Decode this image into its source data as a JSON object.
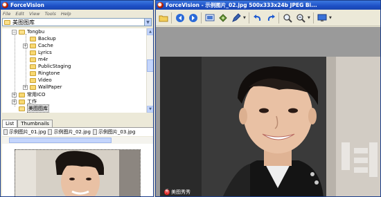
{
  "left_window": {
    "title": "ForceVision",
    "menu": [
      "File",
      "Edit",
      "View",
      "Tools",
      "Help"
    ],
    "path_combo": "美图图库",
    "tree": {
      "root": "Tongbu",
      "items": [
        "Backup",
        "Cache",
        "Lyrics",
        "m4r",
        "PublicStaging",
        "Ringtone",
        "Video",
        "WallPaper"
      ],
      "siblings": [
        "常用ICO",
        "工作"
      ],
      "selected": "美图图库"
    },
    "tabs": [
      "List",
      "Thumbnails"
    ],
    "thumb_files": [
      "示例图片_01.jpg",
      "示例图片_02.jpg",
      "示例图片_03.jpg"
    ]
  },
  "right_window": {
    "title": "ForceVision - 示例图片_02.jpg  500x333x24b  JPEG Bi..."
  },
  "watermark": {
    "text": "美图秀秀"
  },
  "icons": [
    "folder-icon",
    "back-icon",
    "forward-icon",
    "view-icon",
    "crop-icon",
    "pen-icon",
    "undo-icon",
    "redo-icon",
    "zoom-in-icon",
    "zoom-out-icon",
    "monitor-icon"
  ],
  "colors": {
    "titlebar": "#1d4fc5",
    "window_bg": "#ece9d8",
    "tree_folder": "#f8d872",
    "viewer_bg": "#9a9a9a"
  }
}
